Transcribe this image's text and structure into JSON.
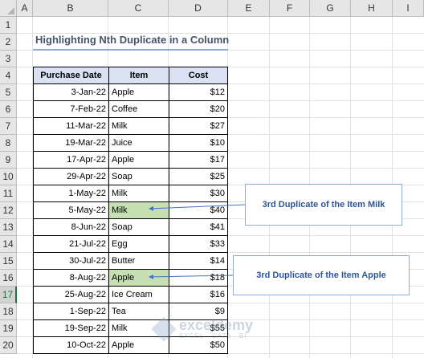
{
  "columns": [
    "A",
    "B",
    "C",
    "D",
    "E",
    "F",
    "G",
    "H",
    "I"
  ],
  "rows": [
    "1",
    "2",
    "3",
    "4",
    "5",
    "6",
    "7",
    "8",
    "9",
    "10",
    "11",
    "12",
    "13",
    "14",
    "15",
    "16",
    "17",
    "18",
    "19",
    "20"
  ],
  "selected_row": "17",
  "title": "Highlighting Nth Duplicate in a Column",
  "table": {
    "headers": [
      "Purchase Date",
      "Item",
      "Cost"
    ],
    "rows": [
      {
        "date": "3-Jan-22",
        "item": "Apple",
        "cost": "$12"
      },
      {
        "date": "7-Feb-22",
        "item": "Coffee",
        "cost": "$20"
      },
      {
        "date": "11-Mar-22",
        "item": "Milk",
        "cost": "$27"
      },
      {
        "date": "19-Mar-22",
        "item": "Juice",
        "cost": "$10"
      },
      {
        "date": "17-Apr-22",
        "item": "Apple",
        "cost": "$17"
      },
      {
        "date": "29-Apr-22",
        "item": "Soap",
        "cost": "$25"
      },
      {
        "date": "1-May-22",
        "item": "Milk",
        "cost": "$30"
      },
      {
        "date": "5-May-22",
        "item": "Milk",
        "cost": "$40",
        "highlight": true
      },
      {
        "date": "8-Jun-22",
        "item": "Soap",
        "cost": "$41"
      },
      {
        "date": "21-Jul-22",
        "item": "Egg",
        "cost": "$33"
      },
      {
        "date": "30-Jul-22",
        "item": "Butter",
        "cost": "$14"
      },
      {
        "date": "8-Aug-22",
        "item": "Apple",
        "cost": "$18",
        "highlight": true
      },
      {
        "date": "25-Aug-22",
        "item": "Ice Cream",
        "cost": "$16"
      },
      {
        "date": "1-Sep-22",
        "item": "Tea",
        "cost": "$9"
      },
      {
        "date": "19-Sep-22",
        "item": "Milk",
        "cost": "$55"
      },
      {
        "date": "10-Oct-22",
        "item": "Apple",
        "cost": "$50"
      }
    ]
  },
  "callouts": {
    "milk": "3rd Duplicate of the Item Milk",
    "apple": "3rd Duplicate of the Item Apple"
  },
  "watermark": {
    "main": "exceldemy",
    "sub": "EXCEL · DATA · BI"
  },
  "colors": {
    "header_fill": "#d9e1f2",
    "highlight_fill": "#c6e0b4",
    "callout_text": "#2f5597",
    "title_text": "#44546a"
  }
}
